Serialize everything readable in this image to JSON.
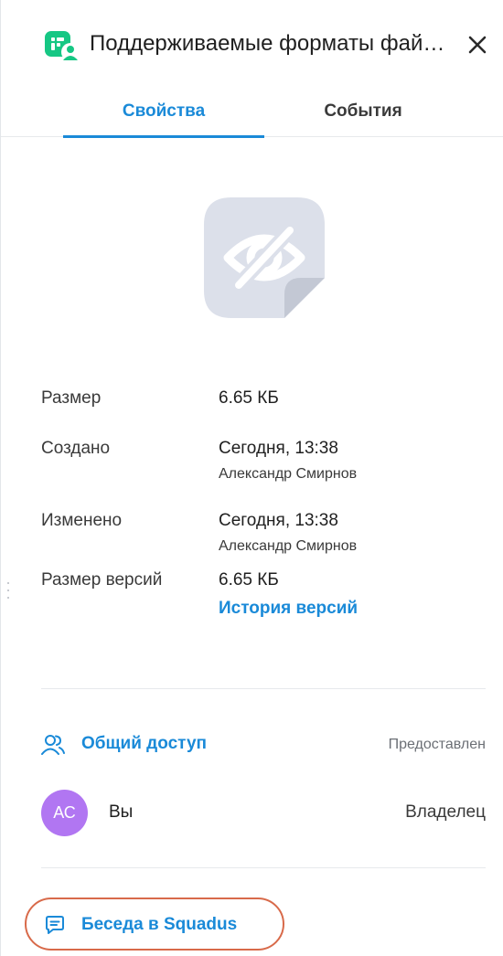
{
  "header": {
    "title": "Поддерживаемые форматы файлов",
    "app_icon": "file-app-icon",
    "close_icon": "close-icon"
  },
  "tabs": [
    {
      "label": "Свойства",
      "active": true
    },
    {
      "label": "События",
      "active": false
    }
  ],
  "preview": {
    "icon": "no-preview-eye-slash-icon"
  },
  "properties": {
    "size": {
      "label": "Размер",
      "value": "6.65 КБ"
    },
    "created": {
      "label": "Создано",
      "value": "Сегодня, 13:38",
      "author": "Александр Смирнов"
    },
    "modified": {
      "label": "Изменено",
      "value": "Сегодня, 13:38",
      "author": "Александр Смирнов"
    },
    "versions_size": {
      "label": "Размер версий",
      "value": "6.65 КБ",
      "link": "История версий"
    }
  },
  "sharing": {
    "label": "Общий доступ",
    "status": "Предоставлен",
    "icon": "users-icon",
    "users": [
      {
        "initials": "АС",
        "name": "Вы",
        "role": "Владелец",
        "avatar_color": "#B176F2"
      }
    ]
  },
  "chat": {
    "label": "Беседа в Squadus",
    "icon": "chat-icon"
  },
  "colors": {
    "accent": "#1A8AD8",
    "app_icon": "#16C784",
    "highlight_outline": "#D86A4A",
    "preview_bg": "#DCE0EA"
  }
}
